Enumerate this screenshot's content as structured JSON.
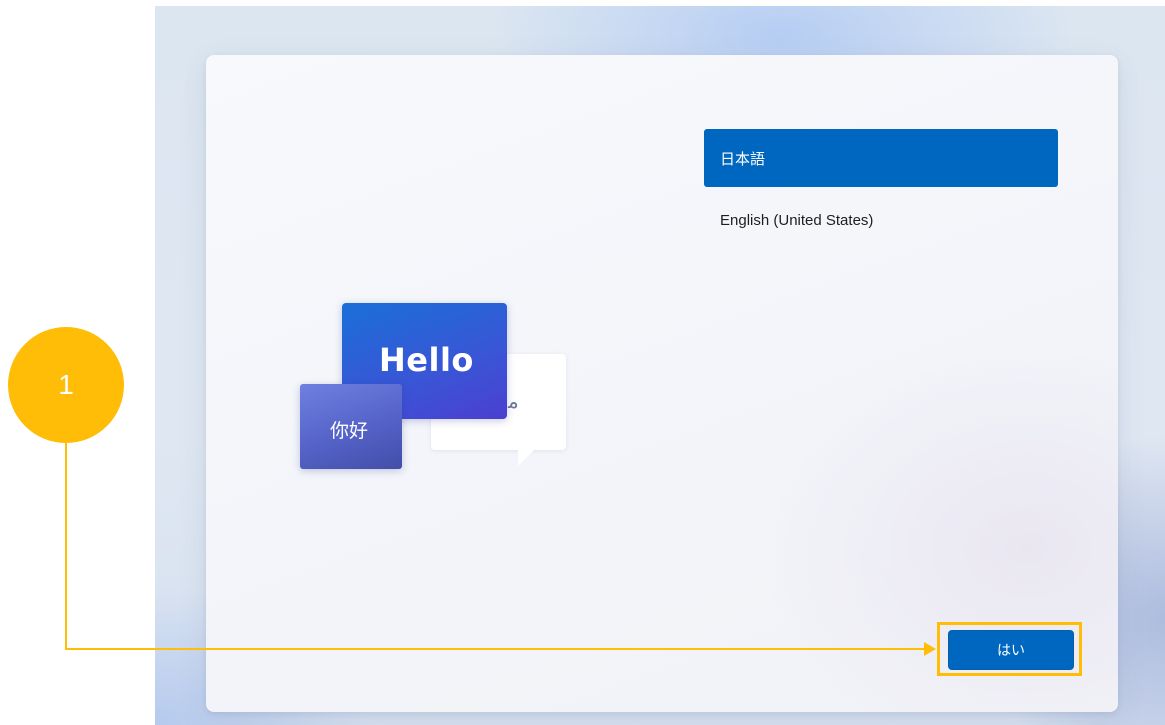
{
  "language_list": {
    "items": [
      {
        "label": "日本語",
        "selected": true
      },
      {
        "label": "English (United States)",
        "selected": false
      }
    ]
  },
  "illustration": {
    "hello_text": "Hello",
    "nihao_text": "你好"
  },
  "actions": {
    "yes_label": "はい"
  },
  "annotation": {
    "step_number": "1"
  },
  "colors": {
    "accent": "#0067c0",
    "highlight": "#ffbd08"
  }
}
